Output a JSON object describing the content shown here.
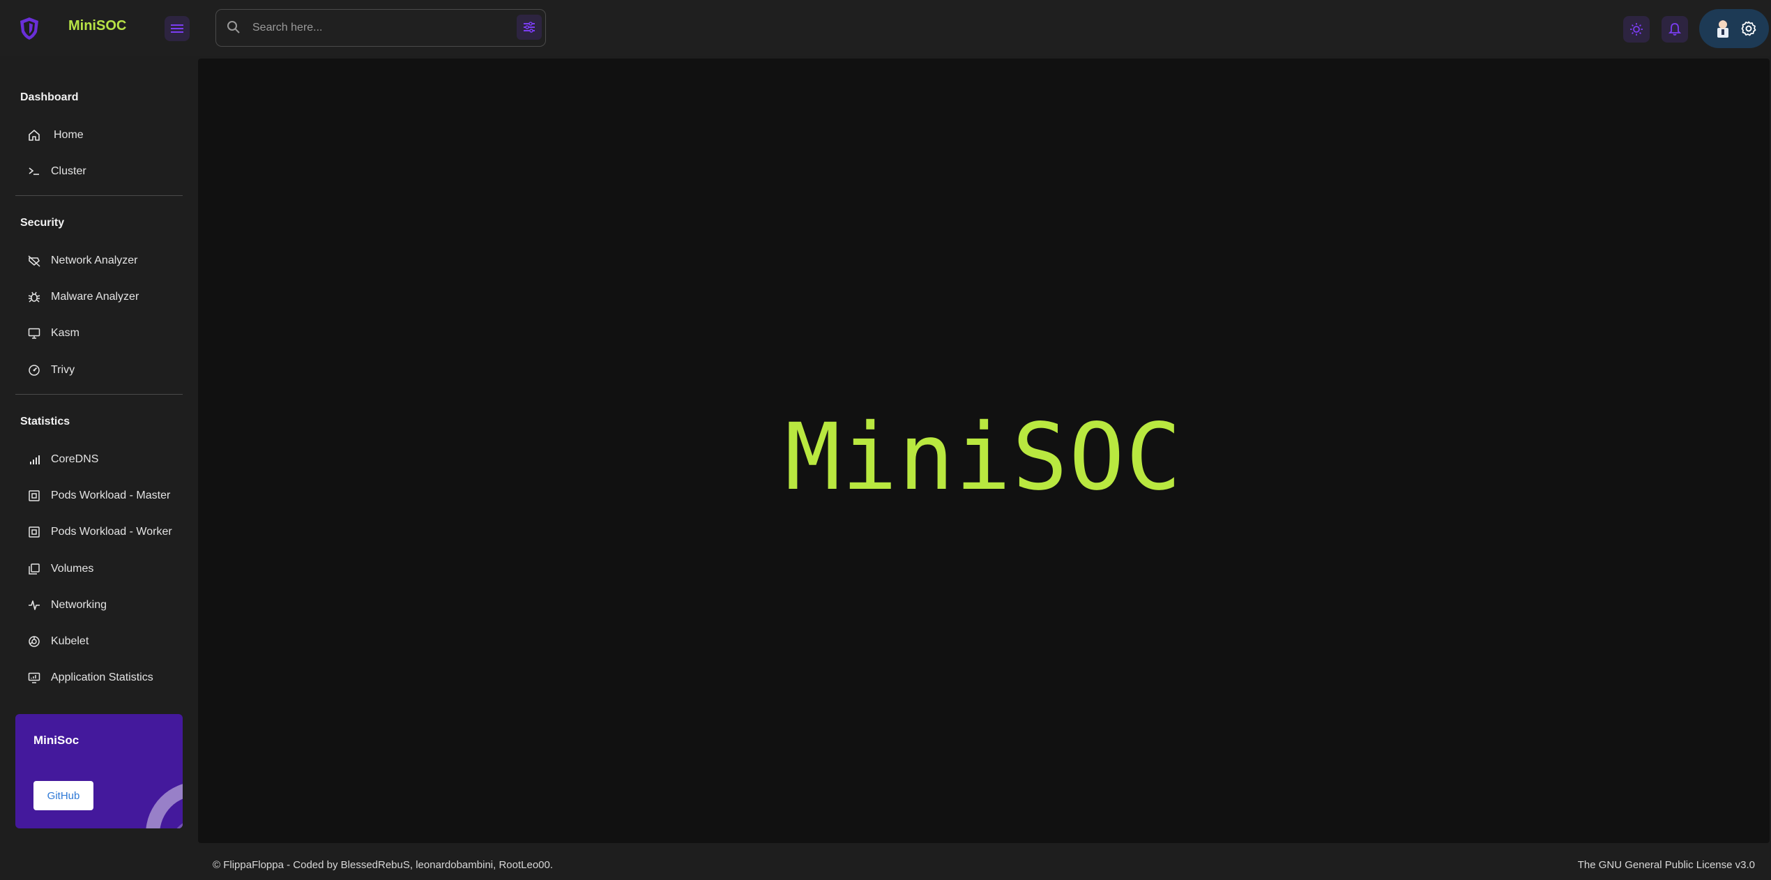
{
  "app": {
    "brand": "MiniSOC"
  },
  "search": {
    "placeholder": "Search here..."
  },
  "sidebar": {
    "sections": [
      {
        "title": "Dashboard",
        "items": [
          {
            "label": "Home",
            "icon": "home-icon"
          },
          {
            "label": "Cluster",
            "icon": "terminal-icon"
          }
        ]
      },
      {
        "title": "Security",
        "items": [
          {
            "label": "Network Analyzer",
            "icon": "network-analyzer-icon"
          },
          {
            "label": "Malware Analyzer",
            "icon": "bug-icon"
          },
          {
            "label": "Kasm",
            "icon": "monitor-icon"
          },
          {
            "label": "Trivy",
            "icon": "gauge-icon"
          }
        ]
      },
      {
        "title": "Statistics",
        "items": [
          {
            "label": "CoreDNS",
            "icon": "signal-bars-icon"
          },
          {
            "label": "Pods Workload - Master",
            "icon": "pod-icon"
          },
          {
            "label": "Pods Workload - Worker",
            "icon": "pod-icon"
          },
          {
            "label": "Volumes",
            "icon": "volumes-icon"
          },
          {
            "label": "Networking",
            "icon": "pulse-icon"
          },
          {
            "label": "Kubelet",
            "icon": "kubelet-icon"
          },
          {
            "label": "Application Statistics",
            "icon": "display-chart-icon"
          }
        ]
      }
    ],
    "promo": {
      "title": "MiniSoc",
      "button": "GitHub"
    }
  },
  "main": {
    "hero": "MiniSOC"
  },
  "footer": {
    "left": "© FlippaFloppa - Coded by BlessedRebuS, leonardobambini, RootLeo00.",
    "right": "The GNU General Public License v3.0"
  },
  "colors": {
    "accent": "#b9e840",
    "purple": "#44199c",
    "icon_bg": "#2d2440",
    "icon": "#7b3df2"
  }
}
